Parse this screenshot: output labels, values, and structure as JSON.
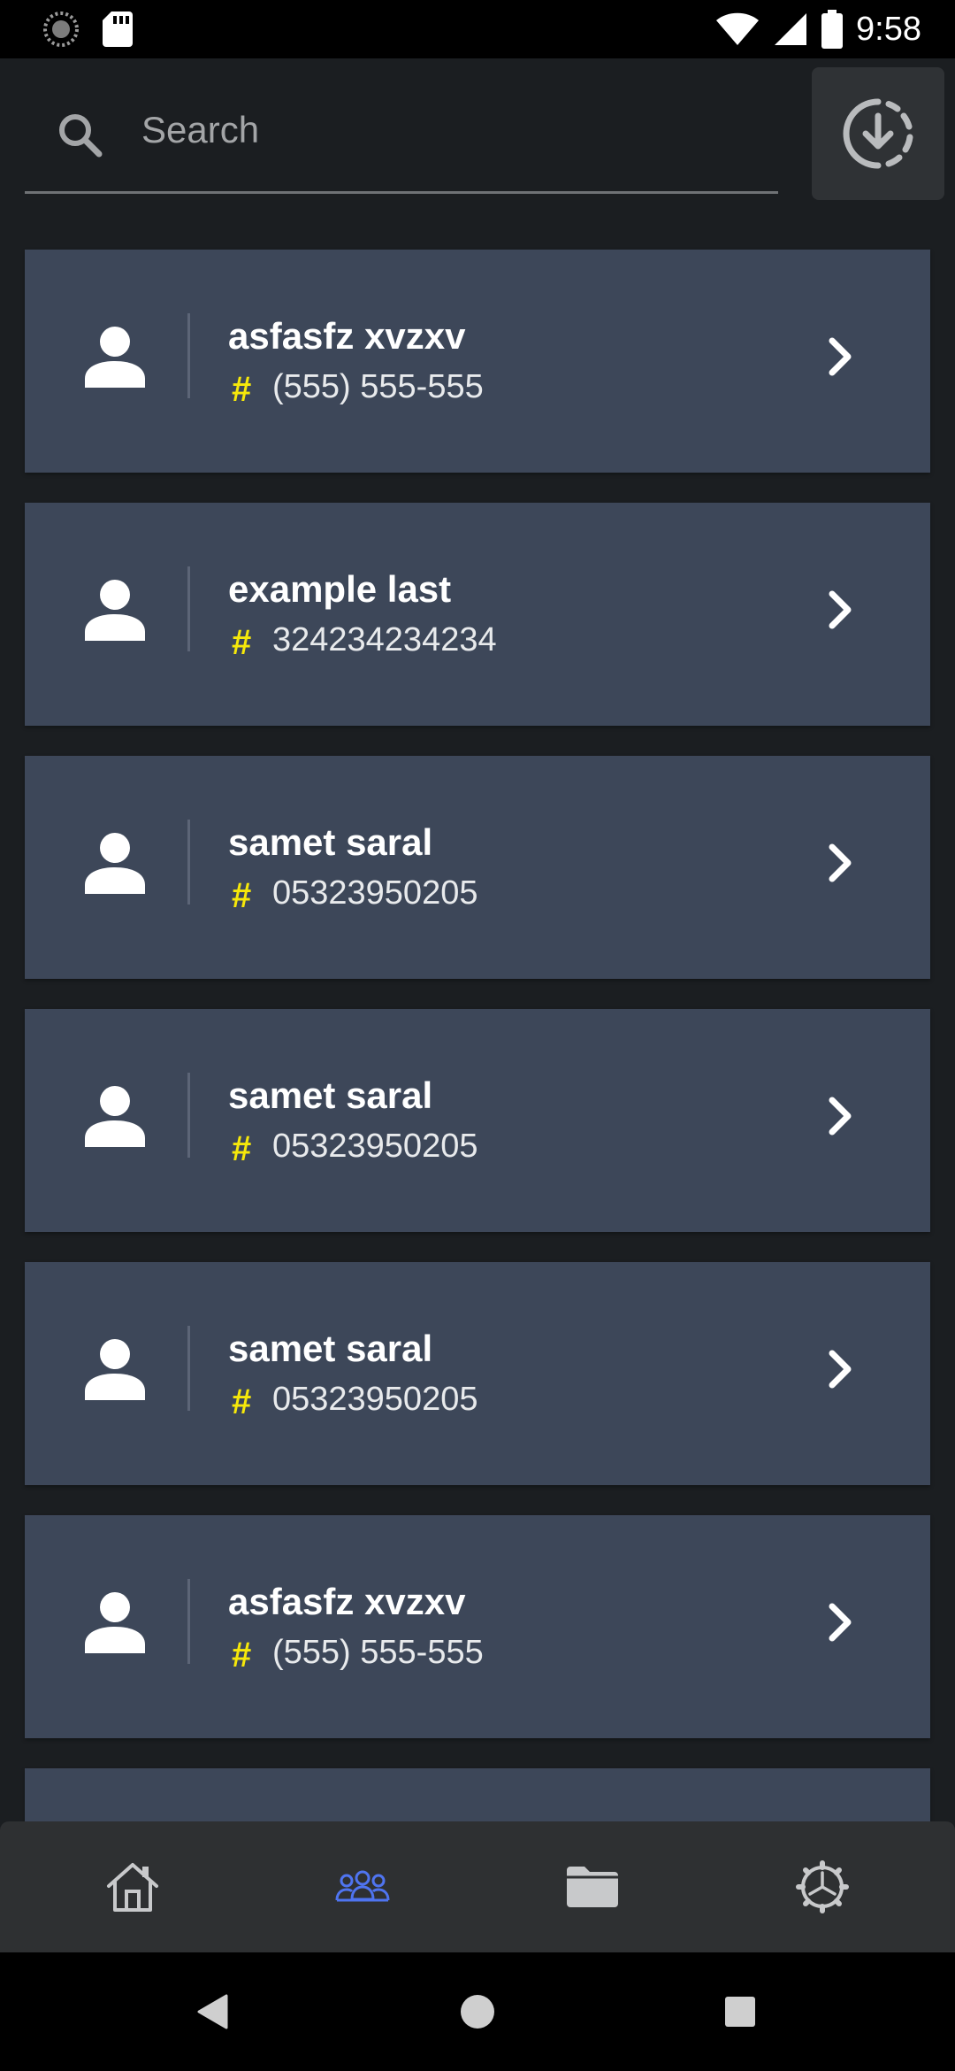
{
  "status_bar": {
    "time": "9:58",
    "icons": [
      "loading-icon",
      "sd-card-icon",
      "wifi-icon",
      "cell-signal-icon",
      "battery-icon"
    ]
  },
  "search": {
    "placeholder": "Search",
    "value": "",
    "icon": "search-icon"
  },
  "header": {
    "download_icon": "download-circle-icon"
  },
  "contacts": [
    {
      "name": "asfasfz xvzxv",
      "phone": "(555) 555-555"
    },
    {
      "name": "example last",
      "phone": "324234234234"
    },
    {
      "name": "samet saral",
      "phone": "05323950205"
    },
    {
      "name": "samet saral",
      "phone": "05323950205"
    },
    {
      "name": "samet saral",
      "phone": "05323950205"
    },
    {
      "name": "asfasfz xvzxv",
      "phone": "(555) 555-555"
    }
  ],
  "contact_hash_glyph": "#",
  "bottom_nav": {
    "items": [
      {
        "icon": "home-icon",
        "active": false
      },
      {
        "icon": "people-icon",
        "active": true
      },
      {
        "icon": "folder-icon",
        "active": false
      },
      {
        "icon": "settings-gear-icon",
        "active": false
      }
    ],
    "active_color": "#4f74f0",
    "inactive_color": "#c8c9cb"
  },
  "colors": {
    "background": "#1b1e21",
    "card": "#3d4759",
    "hash_accent": "#f6e80a",
    "text": "#ffffff"
  }
}
